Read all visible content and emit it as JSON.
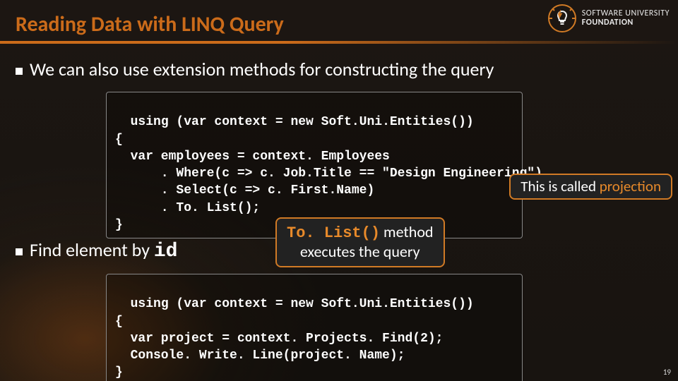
{
  "logo": {
    "line1": "SOFTWARE UNIVERSITY",
    "line2": "FOUNDATION"
  },
  "title": "Reading Data with LINQ Query",
  "bullets": {
    "b1_pre": "We can also use ",
    "b1_em": "extension methods",
    "b1_post": " for constructing the query",
    "b2_pre": "Find element by ",
    "b2_code": "id"
  },
  "code1": "using (var context = new Soft.Uni.Entities())\n{\n  var employees = context. Employees\n      . Where(c => c. Job.Title == \"Design Engineering\")\n      . Select(c => c. First.Name)\n      . To. List();\n}",
  "code2": "using (var context = new Soft.Uni.Entities())\n{\n  var project = context. Projects. Find(2);\n  Console. Write. Line(project. Name);\n}",
  "callouts": {
    "projection_pre": "This is called ",
    "projection_hl": "projection",
    "tolist_l1a": "To. List()",
    "tolist_l1b": " method",
    "tolist_l2": "executes the query"
  },
  "page_number": "19"
}
